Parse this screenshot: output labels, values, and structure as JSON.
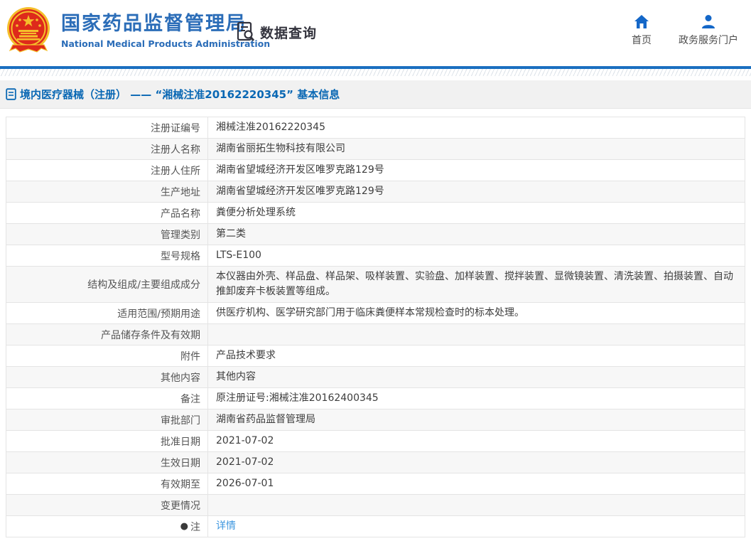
{
  "header": {
    "logo_cn": "国家药品监督管理局",
    "logo_en": "National Medical Products Administration",
    "section_title": "数据查询",
    "nav": [
      {
        "label": "首页",
        "icon": "home-icon"
      },
      {
        "label": "政务服务门户",
        "icon": "user-icon"
      }
    ]
  },
  "breadcrumb": {
    "text": "境内医疗器械（注册） —— “湘械注准20162220345” 基本信息"
  },
  "table": {
    "rows": [
      {
        "label": "注册证编号",
        "value": "湘械注准20162220345"
      },
      {
        "label": "注册人名称",
        "value": "湖南省丽拓生物科技有限公司"
      },
      {
        "label": "注册人住所",
        "value": "湖南省望城经济开发区唯罗克路129号"
      },
      {
        "label": "生产地址",
        "value": "湖南省望城经济开发区唯罗克路129号"
      },
      {
        "label": "产品名称",
        "value": "粪便分析处理系统"
      },
      {
        "label": "管理类别",
        "value": "第二类"
      },
      {
        "label": "型号规格",
        "value": "LTS-E100"
      },
      {
        "label": "结构及组成/主要组成成分",
        "value": "本仪器由外壳、样品盘、样品架、吸样装置、实验盘、加样装置、搅拌装置、显微镜装置、清洗装置、拍摄装置、自动推卸废弃卡板装置等组成。"
      },
      {
        "label": "适用范围/预期用途",
        "value": "供医疗机构、医学研究部门用于临床粪便样本常规检查时的标本处理。"
      },
      {
        "label": "产品储存条件及有效期",
        "value": ""
      },
      {
        "label": "附件",
        "value": "产品技术要求"
      },
      {
        "label": "其他内容",
        "value": "其他内容"
      },
      {
        "label": "备注",
        "value": "原注册证号:湘械注准20162400345"
      },
      {
        "label": "审批部门",
        "value": "湖南省药品监督管理局"
      },
      {
        "label": "批准日期",
        "value": "2021-07-02"
      },
      {
        "label": "生效日期",
        "value": "2021-07-02"
      },
      {
        "label": "有效期至",
        "value": "2026-07-01"
      },
      {
        "label": "变更情况",
        "value": ""
      },
      {
        "label": "注",
        "value": "详情",
        "label_icon": "note-icon",
        "value_is_link": true
      }
    ]
  },
  "colors": {
    "brand_blue": "#2b6db8",
    "bar_blue": "#1a6fc0",
    "breadcrumb_blue": "#0a68b4",
    "nav_icon_blue": "#1467c8",
    "link_blue": "#3e97df",
    "alt_row_bg": "#f7f7f7",
    "border_gray": "#e4e4e4",
    "emblem_red": "#de2a1b",
    "emblem_gold": "#f5bf2b"
  }
}
